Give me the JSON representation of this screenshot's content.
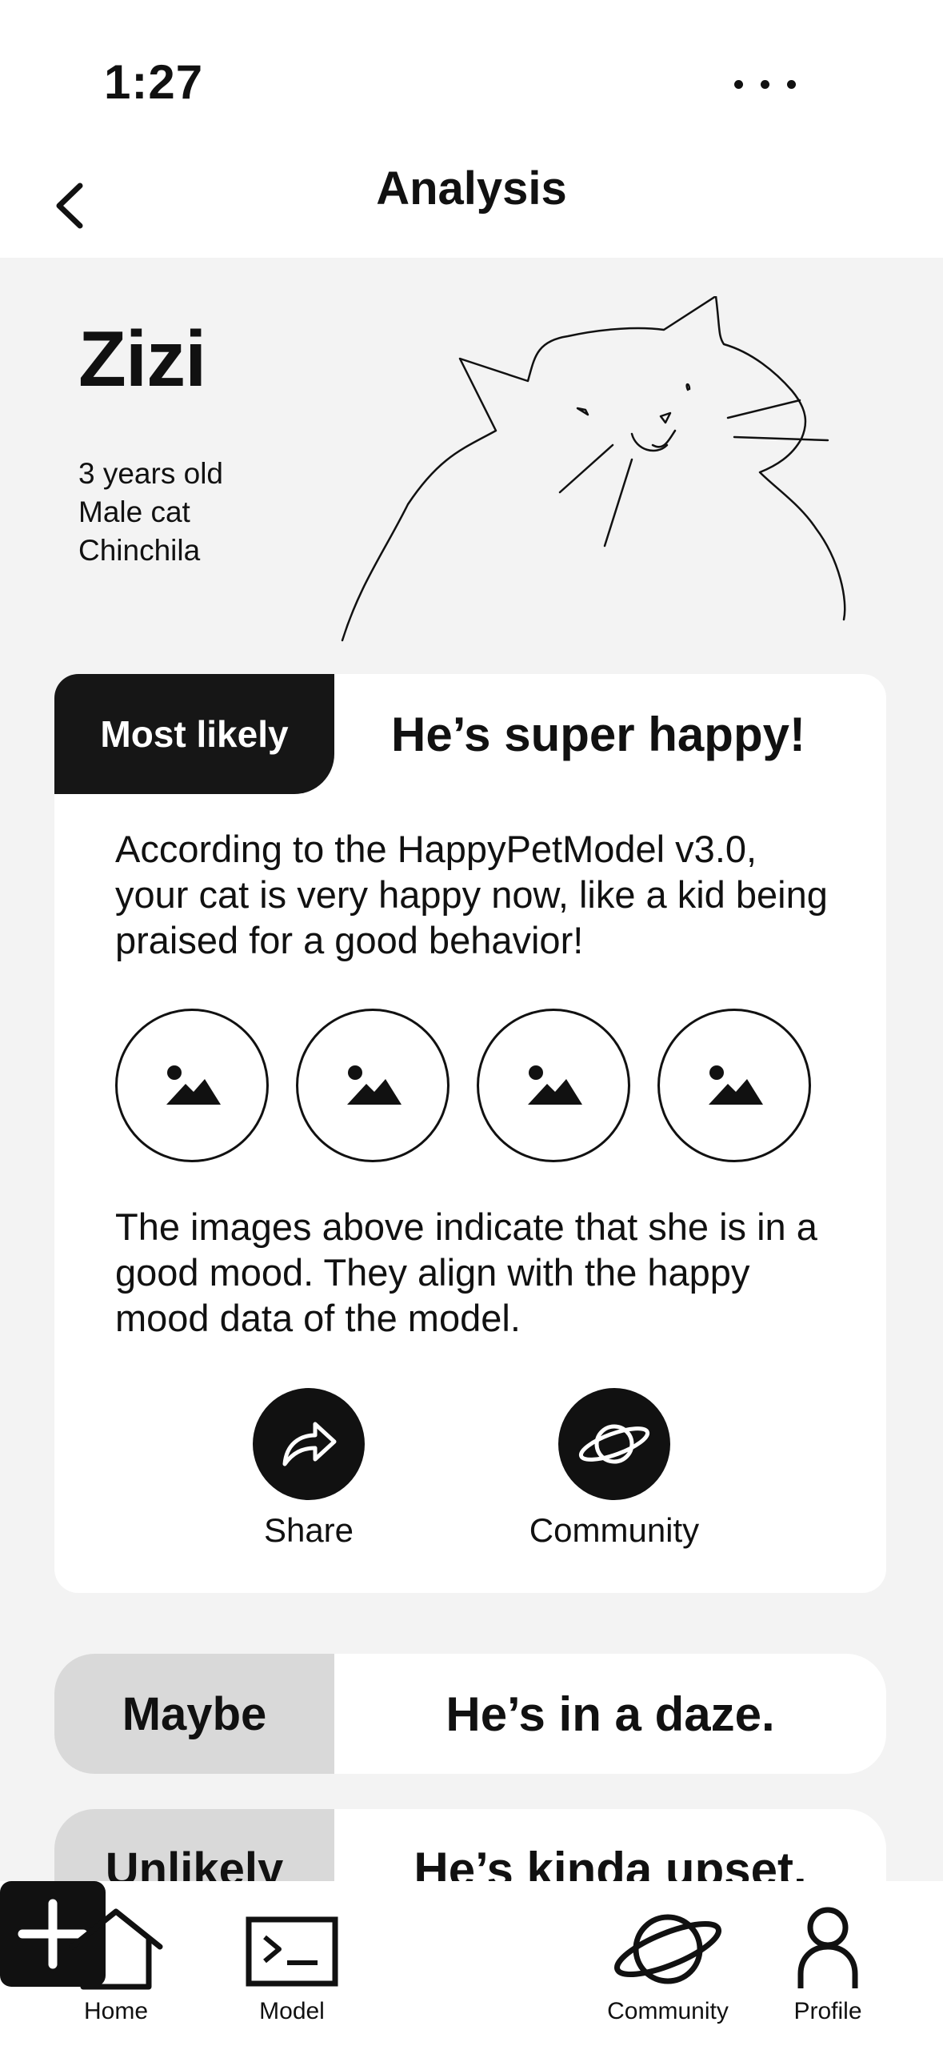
{
  "status_bar": {
    "time": "1:27"
  },
  "header": {
    "title": "Analysis"
  },
  "pet": {
    "name": "Zizi",
    "age": "3 years old",
    "sex": "Male cat",
    "breed": "Chinchila"
  },
  "main_card": {
    "tag": "Most likely",
    "headline": "He’s super happy!",
    "description": "According to the HappyPetModel v3.0, your cat is very happy now, like a kid being praised for a good behavior!",
    "images": [
      "image-icon",
      "image-icon",
      "image-icon",
      "image-icon"
    ],
    "explanation": "The images above indicate that she is in a good mood. They align with the happy mood data of the model.",
    "actions": {
      "share_label": "Share",
      "community_label": "Community"
    }
  },
  "other_results": [
    {
      "tag": "Maybe",
      "headline": "He’s in a daze."
    },
    {
      "tag": "Unlikely",
      "headline": "He’s kinda upset."
    }
  ],
  "tab_bar": {
    "home": "Home",
    "model": "Model",
    "add_icon": "plus-icon",
    "community": "Community",
    "profile": "Profile"
  },
  "colors": {
    "primary": "#111111",
    "background": "#f3f3f3",
    "tag_gray": "#d9d9d9"
  }
}
